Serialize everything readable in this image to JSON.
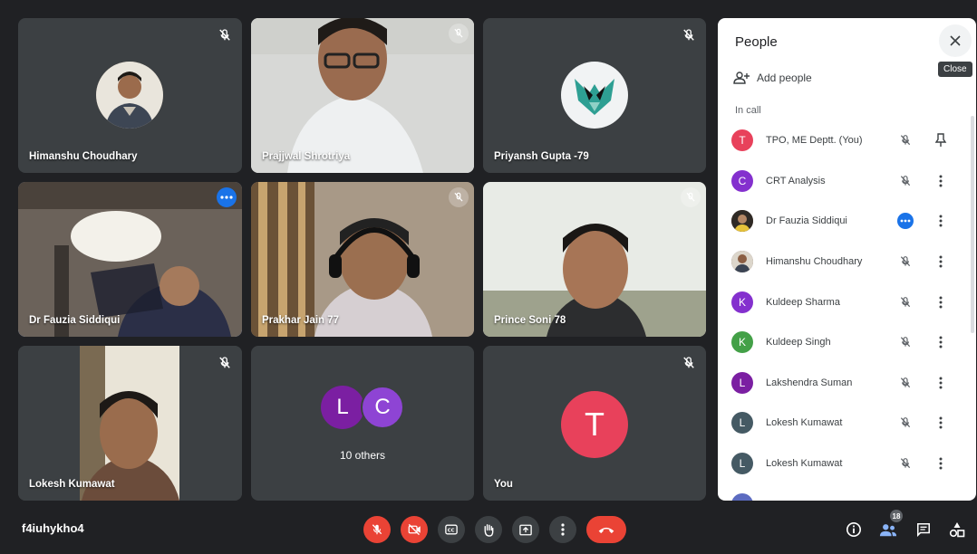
{
  "meeting": {
    "code": "f4iuhykho4"
  },
  "tiles": [
    {
      "name": "Himanshu Choudhary"
    },
    {
      "name": "Prajjwal Shrotriya"
    },
    {
      "name": "Priyansh Gupta -79"
    },
    {
      "name": "Dr Fauzia Siddiqui"
    },
    {
      "name": "Prakhar Jain 77"
    },
    {
      "name": "Prince Soni 78"
    },
    {
      "name": "Lokesh Kumawat"
    },
    {
      "name": "10 others",
      "avatars": [
        "L",
        "C"
      ]
    },
    {
      "name": "You",
      "avatar": "T"
    }
  ],
  "panel": {
    "title": "People",
    "close_tooltip": "Close",
    "add_people": "Add people",
    "in_call_label": "In call",
    "participants": [
      {
        "initial": "T",
        "name": "TPO, ME Deptt. (You)",
        "color": "#e8415b"
      },
      {
        "initial": "C",
        "name": "CRT Analysis",
        "color": "#8430ce"
      },
      {
        "initial": "",
        "name": "Dr Fauzia Siddiqui",
        "color": "#795548"
      },
      {
        "initial": "",
        "name": "Himanshu Choudhary",
        "color": "#5d4037"
      },
      {
        "initial": "K",
        "name": "Kuldeep Sharma",
        "color": "#8430ce"
      },
      {
        "initial": "K",
        "name": "Kuldeep Singh",
        "color": "#43a047"
      },
      {
        "initial": "L",
        "name": "Lakshendra Suman",
        "color": "#7b1fa2"
      },
      {
        "initial": "L",
        "name": "Lokesh Kumawat",
        "color": "#455a64"
      },
      {
        "initial": "L",
        "name": "Lokesh Kumawat",
        "color": "#455a64"
      }
    ]
  },
  "toolbar": {
    "participants_count": "18"
  },
  "colors": {
    "accent": "#8ab4f8",
    "danger": "#ea4335",
    "blue": "#1a73e8"
  }
}
